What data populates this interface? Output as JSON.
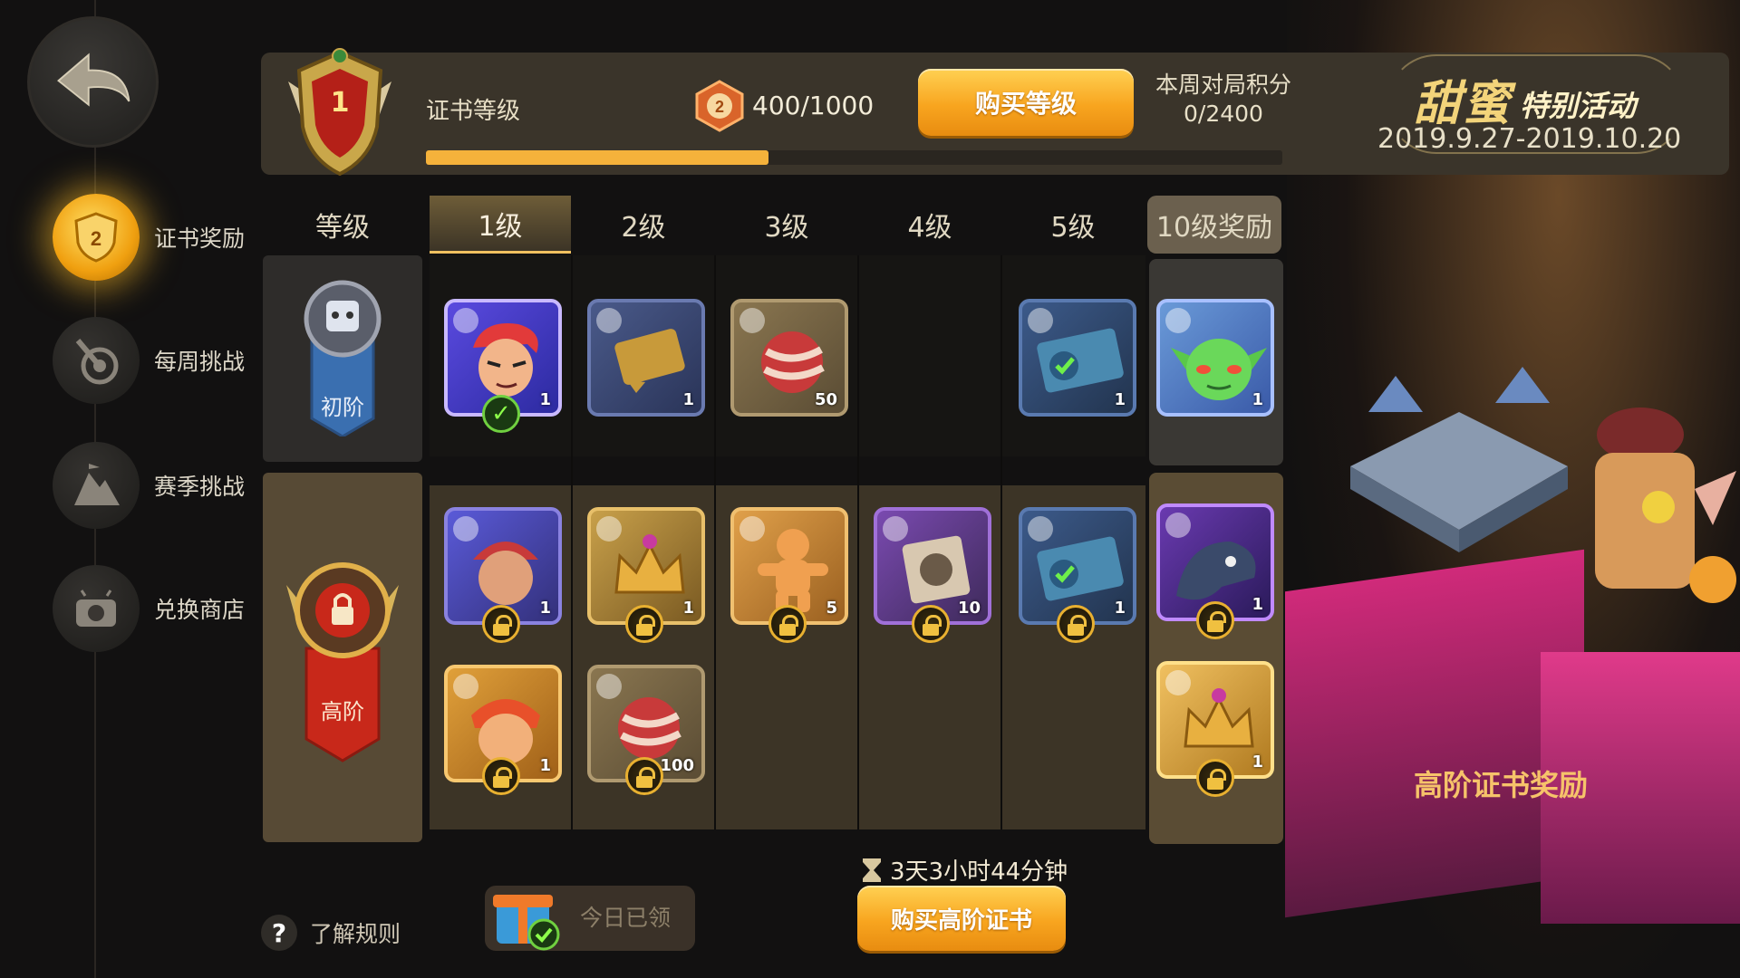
{
  "sidebar": {
    "items": [
      {
        "label": "证书奖励",
        "icon": "shield-icon",
        "active": true
      },
      {
        "label": "每周挑战",
        "icon": "target-icon",
        "active": false
      },
      {
        "label": "赛季挑战",
        "icon": "mountain-icon",
        "active": false
      },
      {
        "label": "兑换商店",
        "icon": "shop-icon",
        "active": false
      }
    ]
  },
  "header": {
    "level": "1",
    "cert_label": "证书等级",
    "xp_text": "400/1000",
    "xp_progress": 0.4,
    "buy_level_label": "购买等级",
    "week_score_label": "本周对局积分",
    "week_score_value": "0/2400"
  },
  "event": {
    "title": "甜蜜",
    "subtitle": "特别活动",
    "dates": "2019.9.27-2019.10.20"
  },
  "table": {
    "level_header": "等级",
    "columns": [
      "1级",
      "2级",
      "3级",
      "4级",
      "5级"
    ],
    "reward_header": "10级奖励",
    "basic_tier_label": "初阶",
    "advanced_tier_label": "高阶",
    "basic_row": [
      {
        "count": "1",
        "claimed": true
      },
      {
        "count": "1"
      },
      {
        "count": "50"
      },
      null,
      {
        "count": "1"
      }
    ],
    "basic_reward": {
      "count": "1"
    },
    "advanced_row1": [
      {
        "count": "1"
      },
      {
        "count": "1"
      },
      {
        "count": "5"
      },
      {
        "count": "10"
      },
      {
        "count": "1"
      }
    ],
    "advanced_row2": [
      {
        "count": "1"
      },
      {
        "count": "100"
      }
    ],
    "advanced_reward": [
      {
        "count": "1"
      },
      {
        "count": "1"
      }
    ]
  },
  "footer": {
    "rules_label": "了解规则",
    "claimed_label": "今日已领",
    "timer_text": "3天3小时44分钟",
    "buy_advanced_label": "购买高阶证书"
  },
  "promo": {
    "advanced_reward_label": "高阶证书奖励"
  }
}
